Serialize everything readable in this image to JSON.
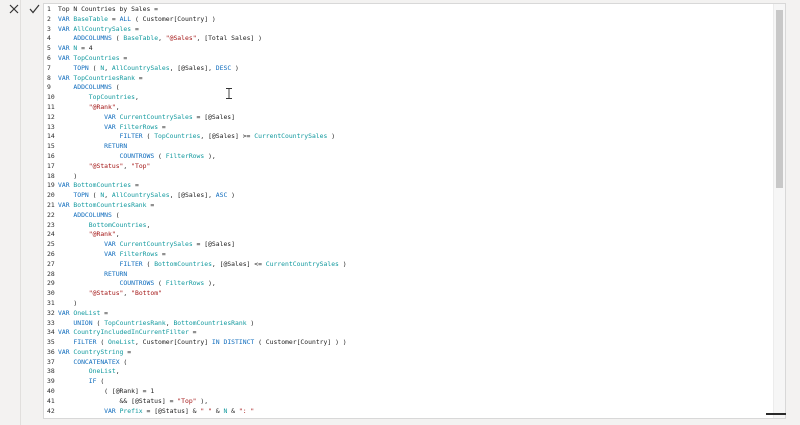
{
  "toolbar": {
    "cancel_icon": "close-icon",
    "commit_icon": "check-icon"
  },
  "editor": {
    "lines": [
      {
        "n": "1",
        "tokens": [
          {
            "t": "Top N Countries by Sales = ",
            "c": "pl"
          }
        ]
      },
      {
        "n": "2",
        "tokens": [
          {
            "t": "VAR ",
            "c": "kw"
          },
          {
            "t": "BaseTable",
            "c": "var"
          },
          {
            "t": " = ",
            "c": "pl"
          },
          {
            "t": "ALL",
            "c": "kw"
          },
          {
            "t": " ( Customer[Country] )",
            "c": "pl"
          }
        ]
      },
      {
        "n": "3",
        "tokens": [
          {
            "t": "VAR ",
            "c": "kw"
          },
          {
            "t": "AllCountrySales",
            "c": "var"
          },
          {
            "t": " =",
            "c": "pl"
          }
        ]
      },
      {
        "n": "4",
        "tokens": [
          {
            "t": "    ADDCOLUMNS",
            "c": "kw"
          },
          {
            "t": " ( ",
            "c": "pl"
          },
          {
            "t": "BaseTable",
            "c": "var"
          },
          {
            "t": ", ",
            "c": "pl"
          },
          {
            "t": "\"@Sales\"",
            "c": "str"
          },
          {
            "t": ", [Total Sales] )",
            "c": "pl"
          }
        ]
      },
      {
        "n": "5",
        "tokens": [
          {
            "t": "VAR ",
            "c": "kw"
          },
          {
            "t": "N",
            "c": "var"
          },
          {
            "t": " = 4",
            "c": "pl"
          }
        ]
      },
      {
        "n": "6",
        "tokens": [
          {
            "t": "VAR ",
            "c": "kw"
          },
          {
            "t": "TopCountries",
            "c": "var"
          },
          {
            "t": " =",
            "c": "pl"
          }
        ]
      },
      {
        "n": "7",
        "tokens": [
          {
            "t": "    TOPN",
            "c": "kw"
          },
          {
            "t": " ( ",
            "c": "pl"
          },
          {
            "t": "N",
            "c": "var"
          },
          {
            "t": ", ",
            "c": "pl"
          },
          {
            "t": "AllCountrySales",
            "c": "var"
          },
          {
            "t": ", [@Sales], ",
            "c": "pl"
          },
          {
            "t": "DESC",
            "c": "kw"
          },
          {
            "t": " )",
            "c": "pl"
          }
        ]
      },
      {
        "n": "8",
        "tokens": [
          {
            "t": "VAR ",
            "c": "kw"
          },
          {
            "t": "TopCountriesRank",
            "c": "var"
          },
          {
            "t": " =",
            "c": "pl"
          }
        ]
      },
      {
        "n": "9",
        "tokens": [
          {
            "t": "    ADDCOLUMNS",
            "c": "kw"
          },
          {
            "t": " (",
            "c": "pl"
          }
        ]
      },
      {
        "n": "10",
        "tokens": [
          {
            "t": "        ",
            "c": "pl"
          },
          {
            "t": "TopCountries",
            "c": "var"
          },
          {
            "t": ",",
            "c": "pl"
          }
        ]
      },
      {
        "n": "11",
        "tokens": [
          {
            "t": "        ",
            "c": "pl"
          },
          {
            "t": "\"@Rank\"",
            "c": "str"
          },
          {
            "t": ",",
            "c": "pl"
          }
        ]
      },
      {
        "n": "12",
        "tokens": [
          {
            "t": "            VAR ",
            "c": "kw"
          },
          {
            "t": "CurrentCountrySales",
            "c": "var"
          },
          {
            "t": " = [@Sales]",
            "c": "pl"
          }
        ]
      },
      {
        "n": "13",
        "tokens": [
          {
            "t": "            VAR ",
            "c": "kw"
          },
          {
            "t": "FilterRows",
            "c": "var"
          },
          {
            "t": " =",
            "c": "pl"
          }
        ]
      },
      {
        "n": "14",
        "tokens": [
          {
            "t": "                FILTER",
            "c": "kw"
          },
          {
            "t": " ( ",
            "c": "pl"
          },
          {
            "t": "TopCountries",
            "c": "var"
          },
          {
            "t": ", [@Sales] >= ",
            "c": "pl"
          },
          {
            "t": "CurrentCountrySales",
            "c": "var"
          },
          {
            "t": " )",
            "c": "pl"
          }
        ]
      },
      {
        "n": "15",
        "tokens": [
          {
            "t": "            RETURN",
            "c": "kw"
          }
        ]
      },
      {
        "n": "16",
        "tokens": [
          {
            "t": "                COUNTROWS",
            "c": "kw"
          },
          {
            "t": " ( ",
            "c": "pl"
          },
          {
            "t": "FilterRows",
            "c": "var"
          },
          {
            "t": " ),",
            "c": "pl"
          }
        ]
      },
      {
        "n": "17",
        "tokens": [
          {
            "t": "        ",
            "c": "pl"
          },
          {
            "t": "\"@Status\"",
            "c": "str"
          },
          {
            "t": ", ",
            "c": "pl"
          },
          {
            "t": "\"Top\"",
            "c": "str"
          }
        ]
      },
      {
        "n": "18",
        "tokens": [
          {
            "t": "    )",
            "c": "pl"
          }
        ]
      },
      {
        "n": "19",
        "tokens": [
          {
            "t": "VAR ",
            "c": "kw"
          },
          {
            "t": "BottomCountries",
            "c": "var"
          },
          {
            "t": " =",
            "c": "pl"
          }
        ]
      },
      {
        "n": "20",
        "tokens": [
          {
            "t": "    TOPN",
            "c": "kw"
          },
          {
            "t": " ( ",
            "c": "pl"
          },
          {
            "t": "N",
            "c": "var"
          },
          {
            "t": ", ",
            "c": "pl"
          },
          {
            "t": "AllCountrySales",
            "c": "var"
          },
          {
            "t": ", [@Sales], ",
            "c": "pl"
          },
          {
            "t": "ASC",
            "c": "kw"
          },
          {
            "t": " )",
            "c": "pl"
          }
        ]
      },
      {
        "n": "21",
        "tokens": [
          {
            "t": "VAR ",
            "c": "kw"
          },
          {
            "t": "BottomCountriesRank",
            "c": "var"
          },
          {
            "t": " =",
            "c": "pl"
          }
        ]
      },
      {
        "n": "22",
        "tokens": [
          {
            "t": "    ADDCOLUMNS",
            "c": "kw"
          },
          {
            "t": " (",
            "c": "pl"
          }
        ]
      },
      {
        "n": "23",
        "tokens": [
          {
            "t": "        ",
            "c": "pl"
          },
          {
            "t": "BottomCountries",
            "c": "var"
          },
          {
            "t": ",",
            "c": "pl"
          }
        ]
      },
      {
        "n": "24",
        "tokens": [
          {
            "t": "        ",
            "c": "pl"
          },
          {
            "t": "\"@Rank\"",
            "c": "str"
          },
          {
            "t": ",",
            "c": "pl"
          }
        ]
      },
      {
        "n": "25",
        "tokens": [
          {
            "t": "            VAR ",
            "c": "kw"
          },
          {
            "t": "CurrentCountrySales",
            "c": "var"
          },
          {
            "t": " = [@Sales]",
            "c": "pl"
          }
        ]
      },
      {
        "n": "26",
        "tokens": [
          {
            "t": "            VAR ",
            "c": "kw"
          },
          {
            "t": "FilterRows",
            "c": "var"
          },
          {
            "t": " =",
            "c": "pl"
          }
        ]
      },
      {
        "n": "27",
        "tokens": [
          {
            "t": "                FILTER",
            "c": "kw"
          },
          {
            "t": " ( ",
            "c": "pl"
          },
          {
            "t": "BottomCountries",
            "c": "var"
          },
          {
            "t": ", [@Sales] <= ",
            "c": "pl"
          },
          {
            "t": "CurrentCountrySales",
            "c": "var"
          },
          {
            "t": " )",
            "c": "pl"
          }
        ]
      },
      {
        "n": "28",
        "tokens": [
          {
            "t": "            RETURN",
            "c": "kw"
          }
        ]
      },
      {
        "n": "29",
        "tokens": [
          {
            "t": "                COUNTROWS",
            "c": "kw"
          },
          {
            "t": " ( ",
            "c": "pl"
          },
          {
            "t": "FilterRows",
            "c": "var"
          },
          {
            "t": " ),",
            "c": "pl"
          }
        ]
      },
      {
        "n": "30",
        "tokens": [
          {
            "t": "        ",
            "c": "pl"
          },
          {
            "t": "\"@Status\"",
            "c": "str"
          },
          {
            "t": ", ",
            "c": "pl"
          },
          {
            "t": "\"Bottom\"",
            "c": "str"
          }
        ]
      },
      {
        "n": "31",
        "tokens": [
          {
            "t": "    )",
            "c": "pl"
          }
        ]
      },
      {
        "n": "32",
        "tokens": [
          {
            "t": "VAR ",
            "c": "kw"
          },
          {
            "t": "OneList",
            "c": "var"
          },
          {
            "t": " =",
            "c": "pl"
          }
        ]
      },
      {
        "n": "33",
        "tokens": [
          {
            "t": "    UNION",
            "c": "kw"
          },
          {
            "t": " ( ",
            "c": "pl"
          },
          {
            "t": "TopCountriesRank",
            "c": "var"
          },
          {
            "t": ", ",
            "c": "pl"
          },
          {
            "t": "BottomCountriesRank",
            "c": "var"
          },
          {
            "t": " )",
            "c": "pl"
          }
        ]
      },
      {
        "n": "34",
        "tokens": [
          {
            "t": "VAR ",
            "c": "kw"
          },
          {
            "t": "CountryIncludedInCurrentFilter",
            "c": "var"
          },
          {
            "t": " =",
            "c": "pl"
          }
        ]
      },
      {
        "n": "35",
        "tokens": [
          {
            "t": "    FILTER",
            "c": "kw"
          },
          {
            "t": " ( ",
            "c": "pl"
          },
          {
            "t": "OneList",
            "c": "var"
          },
          {
            "t": ", Customer[Country] ",
            "c": "pl"
          },
          {
            "t": "IN",
            "c": "kw"
          },
          {
            "t": " ",
            "c": "pl"
          },
          {
            "t": "DISTINCT",
            "c": "kw"
          },
          {
            "t": " ( Customer[Country] ) )",
            "c": "pl"
          }
        ]
      },
      {
        "n": "36",
        "tokens": [
          {
            "t": "VAR ",
            "c": "kw"
          },
          {
            "t": "CountryString",
            "c": "var"
          },
          {
            "t": " =",
            "c": "pl"
          }
        ]
      },
      {
        "n": "37",
        "tokens": [
          {
            "t": "    CONCATENATEX",
            "c": "kw"
          },
          {
            "t": " (",
            "c": "pl"
          }
        ]
      },
      {
        "n": "38",
        "tokens": [
          {
            "t": "        ",
            "c": "pl"
          },
          {
            "t": "OneList",
            "c": "var"
          },
          {
            "t": ",",
            "c": "pl"
          }
        ]
      },
      {
        "n": "39",
        "tokens": [
          {
            "t": "        IF",
            "c": "kw"
          },
          {
            "t": " (",
            "c": "pl"
          }
        ]
      },
      {
        "n": "40",
        "tokens": [
          {
            "t": "            ( [@Rank] = 1",
            "c": "pl"
          }
        ]
      },
      {
        "n": "41",
        "tokens": [
          {
            "t": "                && [@Status] = ",
            "c": "pl"
          },
          {
            "t": "\"Top\"",
            "c": "str"
          },
          {
            "t": " ),",
            "c": "pl"
          }
        ]
      },
      {
        "n": "42",
        "tokens": [
          {
            "t": "            VAR ",
            "c": "kw"
          },
          {
            "t": "Prefix",
            "c": "var"
          },
          {
            "t": " = [@Status] & ",
            "c": "pl"
          },
          {
            "t": "\" \"",
            "c": "str"
          },
          {
            "t": " & ",
            "c": "pl"
          },
          {
            "t": "N",
            "c": "var"
          },
          {
            "t": " & ",
            "c": "pl"
          },
          {
            "t": "\": \"",
            "c": "str"
          }
        ]
      }
    ]
  }
}
